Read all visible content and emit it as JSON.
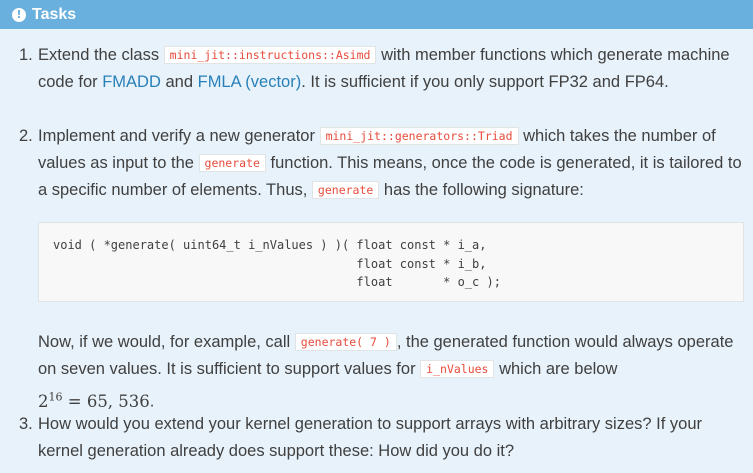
{
  "admonition": {
    "title": "Tasks",
    "icon": "exclamation-circle-icon"
  },
  "tasks": [
    {
      "number": "1.",
      "t1": "Extend the class",
      "code1": "mini_jit::instructions::Asimd",
      "t2": "with member functions which generate",
      "t3": "machine code for",
      "link1": "FMADD",
      "t4": "and",
      "link2": "FMLA (vector)",
      "t5": ". It is sufficient if you only support FP32 and",
      "t6": "FP64."
    },
    {
      "number": "2.",
      "t1": "Implement and verify a new generator",
      "code1": "mini_jit::generators::Triad",
      "t2": "which takes the number",
      "t3": "of values as input to the",
      "code2": "generate",
      "t4": "function. This means, once the code is generated, it is",
      "t5": "tailored to a specific number of elements. Thus,",
      "code3": "generate",
      "t6": "has the following signature:",
      "codeblock": "void ( *generate( uint64_t i_nValues ) )( float const * i_a,\n                                          float const * i_b,\n                                          float       * o_c );",
      "p2_t1": "Now, if we would, for example, call",
      "p2_code1": "generate( 7 )",
      "p2_t2": ", the generated function would always",
      "p2_t3": "operate on seven values. It is sufficient to support values for",
      "p2_code2": "i_nValues",
      "p2_t4": "which are below",
      "math_base": "2",
      "math_exp": "16",
      "math_rest": " = 65, 536",
      "math_end": "."
    },
    {
      "number": "3.",
      "t1": "How would you extend your kernel generation to support arrays with arbitrary sizes? If your",
      "t2": "kernel generation already does support these: How did you do it?"
    }
  ],
  "colors": {
    "header_bg": "#6ab0de",
    "body_bg": "#e7f2fa",
    "link": "#2980b9",
    "code": "#e74c3c"
  }
}
